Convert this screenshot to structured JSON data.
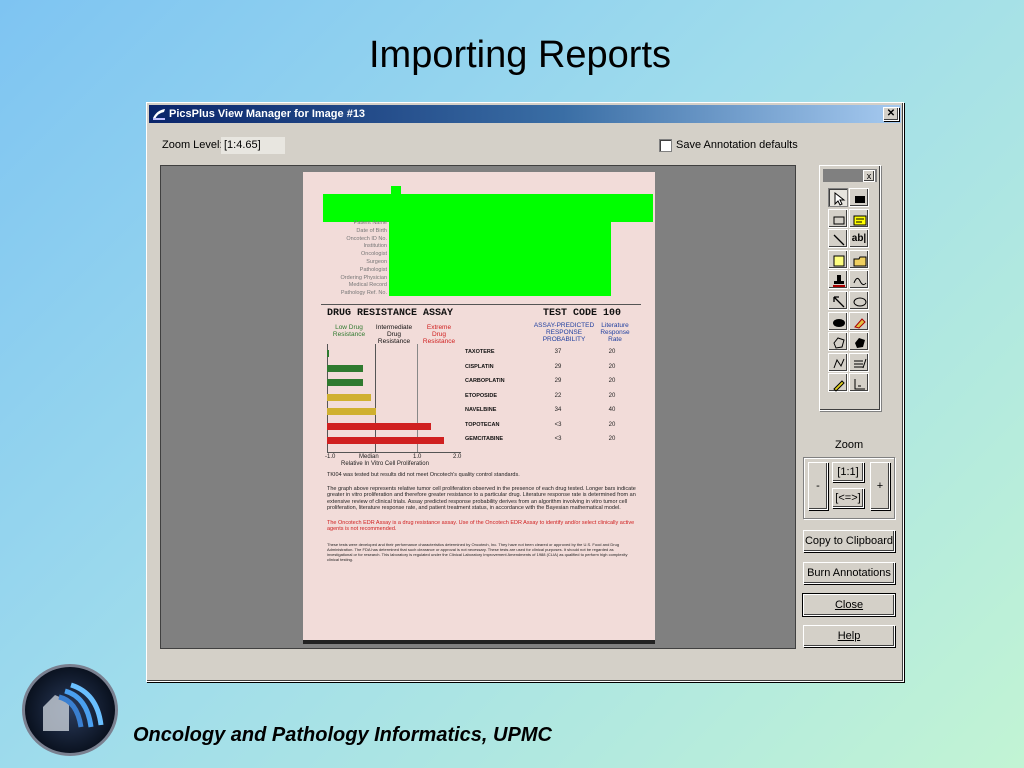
{
  "slide": {
    "title": "Importing Reports",
    "footer": "Oncology and Pathology Informatics, UPMC"
  },
  "window": {
    "title": "PicsPlus View Manager for Image #13",
    "close_glyph": "✕",
    "zoom_level_label": "Zoom Level:",
    "zoom_level_value": "[1:4.65]",
    "save_defaults_label": "Save Annotation defaults",
    "save_defaults_checked": false
  },
  "report": {
    "patient_fields": [
      "Patient Name",
      "Date of Birth",
      "Oncotech ID No.",
      "Institution",
      "Oncologist",
      "Surgeon",
      "Pathologist",
      "Ordering Physician",
      "Medical Record",
      "Pathology Ref. No."
    ],
    "assay_title": "DRUG RESISTANCE ASSAY",
    "test_code": "TEST CODE 100",
    "col_low": "Low Drug Resistance",
    "col_intermediate": "Intermediate Drug Resistance",
    "col_extreme": "Extreme Drug Resistance",
    "col_assay_prob": "ASSAY-PREDICTED RESPONSE PROBABILITY",
    "col_literature": "Literature Response Rate",
    "drugs": [
      {
        "name": "TAXOTERE",
        "prob": "37",
        "lit": "20",
        "bar": 0.0,
        "color": "#2f7a2f"
      },
      {
        "name": "CISPLATIN",
        "prob": "29",
        "lit": "20",
        "bar": 0.28,
        "color": "#2f7a2f"
      },
      {
        "name": "CARBOPLATIN",
        "prob": "29",
        "lit": "20",
        "bar": 0.28,
        "color": "#2f7a2f"
      },
      {
        "name": "ETOPOSIDE",
        "prob": "22",
        "lit": "20",
        "bar": 0.34,
        "color": "#d0b030"
      },
      {
        "name": "NAVELBINE",
        "prob": "34",
        "lit": "40",
        "bar": 0.38,
        "color": "#d0b030"
      },
      {
        "name": "TOPOTECAN",
        "prob": "<3",
        "lit": "20",
        "bar": 0.8,
        "color": "#d02020"
      },
      {
        "name": "GEMCITABINE",
        "prob": "<3",
        "lit": "20",
        "bar": 0.9,
        "color": "#d02020"
      }
    ],
    "axis_ticks": [
      "-1.0",
      "Median",
      "1.0",
      "2.0"
    ],
    "axis_label": "Relative In Vitro Cell Proliferation",
    "note1": "TKI04 was tested but results did not meet Oncotech's quality control standards.",
    "para1": "The graph above represents relative tumor cell proliferation observed in the presence of each drug tested. Longer bars indicate greater in vitro proliferation and therefore greater resistance to a particular drug. Literature response rate is determined from an extensive review of clinical trials. Assay predicted response probability derives from an algorithm involving in vitro tumor cell proliferation, literature response rate, and patient treatment status, in accordance with the Bayesian mathematical model.",
    "para2": "The Oncotech EDR Assay is a drug resistance assay. Use of the Oncotech EDR Assay to identify and/or select clinically active agents is not recommended.",
    "para3": "These tests were developed and their performance characteristics determined by Oncotech, Inc. They have not been cleared or approved by the U.S. Food and Drug Administration. The FDA has determined that such clearance or approval is not necessary. These tests are used for clinical purposes. It should not be regarded as investigational or for research. This laboratory is regulated under the Clinical Laboratory Improvement Amendments of 1988 (CLIA) as qualified to perform high complexity clinical testing."
  },
  "toolbox": {
    "close_glyph": "x",
    "tools": [
      "pointer-tool",
      "filled-rect-tool",
      "rect-tool",
      "highlight-note-tool",
      "line-tool",
      "text-tool",
      "sticky-note-tool",
      "open-folder-tool",
      "stamp-tool",
      "freehand-tool",
      "arrow-tool",
      "ellipse-tool",
      "filled-ellipse-tool",
      "eraser-tool",
      "polygon-tool",
      "filled-polygon-tool",
      "polyline-tool",
      "edit-text-tool",
      "highlighter-tool",
      "measure-tool"
    ],
    "text_tool_label": "ab|"
  },
  "zoom_panel": {
    "label": "Zoom",
    "minus": "-",
    "plus": "+",
    "one_to_one": "[1:1]",
    "fit": "[<=>]"
  },
  "buttons": {
    "copy": "Copy to Clipboard",
    "burn": "Burn Annotations",
    "close": "Close",
    "help": "Help"
  }
}
